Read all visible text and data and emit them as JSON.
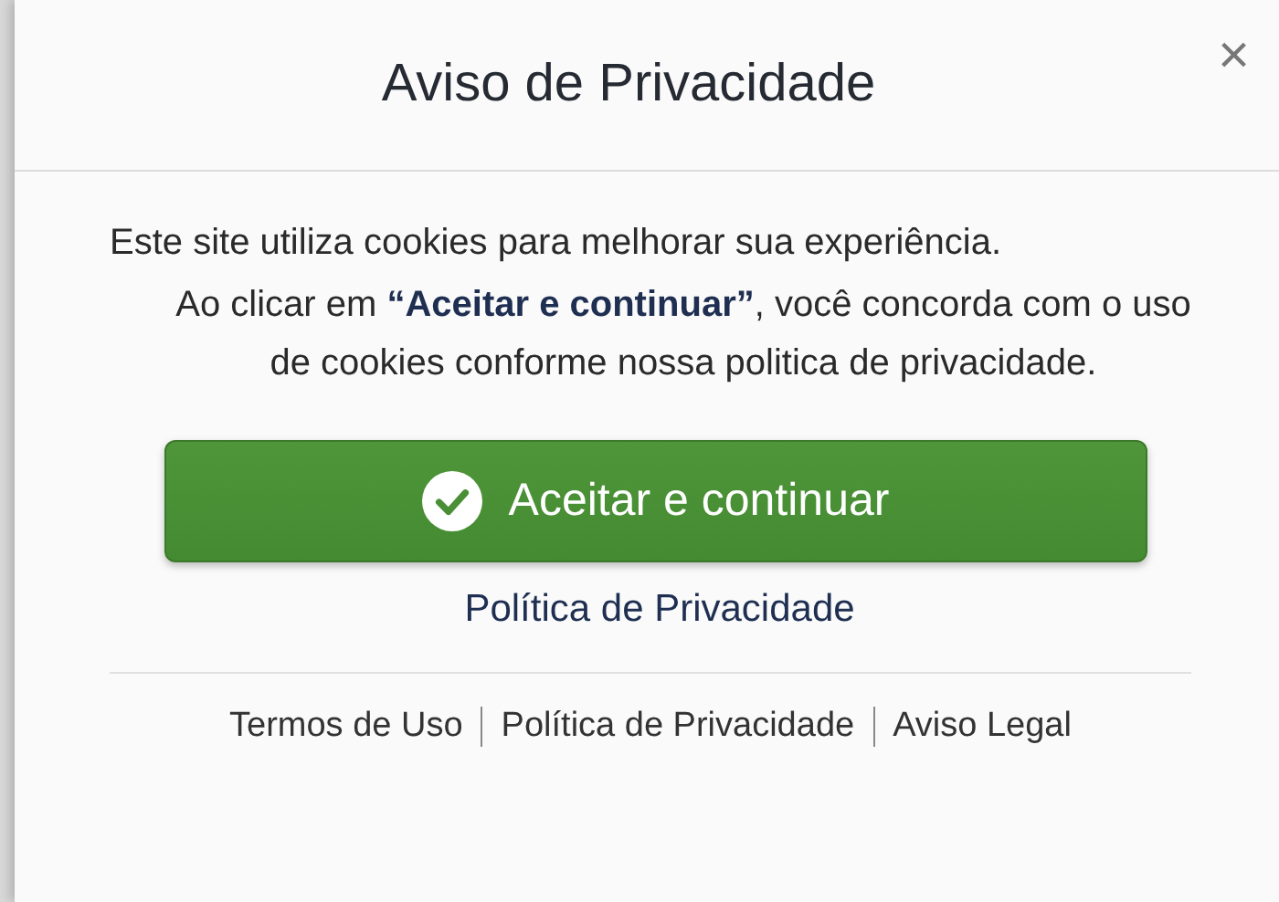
{
  "dialog": {
    "title": "Aviso de Privacidade",
    "close": "×"
  },
  "body": {
    "intro": "Este site utiliza cookies para melhorar sua experiência.",
    "detail": "Ao clicar em **“Aceitar e continuar”**, você concorda com o uso de cookies conforme nossa politica de privacidade.",
    "accept_button": "Aceitar e continuar",
    "policy_link": "Política de Privacidade"
  },
  "footer_links": [
    "Termos de Uso",
    "Política de Privacidade",
    "Aviso Legal"
  ]
}
